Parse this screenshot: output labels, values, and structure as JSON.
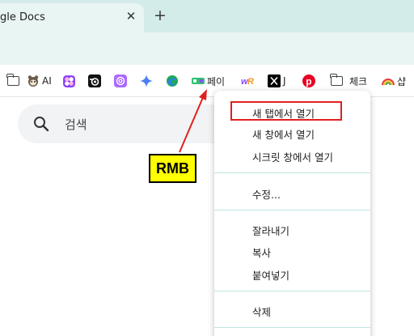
{
  "tab": {
    "title": "gle Docs",
    "close_glyph": "✕",
    "new_tab_glyph": "+"
  },
  "bookmarks": {
    "items": [
      {
        "label": "",
        "icon": "folder-icon"
      },
      {
        "label": "AI",
        "icon": "ai-mascot-icon"
      },
      {
        "label": "",
        "icon": "figma-icon"
      },
      {
        "label": "",
        "icon": "blender-icon"
      },
      {
        "label": "",
        "icon": "chatgpt-icon"
      },
      {
        "label": "",
        "icon": "gemini-icon"
      },
      {
        "label": "",
        "icon": "edge-icon"
      },
      {
        "label": "페이",
        "icon": "pay-icon"
      },
      {
        "label": "",
        "icon": "wr-icon"
      },
      {
        "label": "J",
        "icon": "x-icon"
      },
      {
        "label": "",
        "icon": "pinterest-icon"
      },
      {
        "label": "체크",
        "icon": "folder-icon"
      },
      {
        "label": "샵",
        "icon": "rainbow-icon"
      }
    ]
  },
  "search": {
    "placeholder": "검색"
  },
  "context_menu": {
    "group1": [
      "새 탭에서 열기",
      "새 창에서 열기",
      "시크릿 창에서 열기"
    ],
    "group2": [
      "수정..."
    ],
    "group3": [
      "잘라내기",
      "복사",
      "붙여넣기"
    ],
    "group4": [
      "삭제"
    ]
  },
  "annotation": {
    "label": "RMB",
    "color": "#ffff00",
    "arrow_color": "#e02020"
  },
  "colors": {
    "tabstrip": "#d3ebe9",
    "toolbar": "#e9f5f3",
    "highlight_border": "#e02020"
  }
}
